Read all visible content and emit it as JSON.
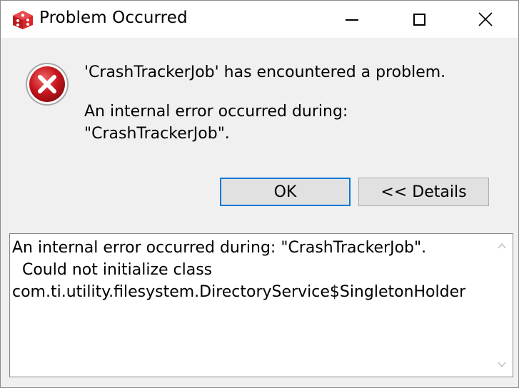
{
  "window": {
    "title": "Problem Occurred",
    "buttons": {
      "minimize": "minimize",
      "maximize": "maximize",
      "close": "close"
    }
  },
  "message": {
    "headline": "'CrashTrackerJob' has encountered a problem.",
    "detail_line1": "An internal error occurred during:",
    "detail_line2": "\"CrashTrackerJob\"."
  },
  "buttons": {
    "ok_label": "OK",
    "details_label": "<< Details"
  },
  "details": {
    "text": "An internal error occurred during: \"CrashTrackerJob\".\n  Could not initialize class\ncom.ti.utility.filesystem.DirectoryService$SingletonHolder"
  },
  "icons": {
    "app": "app-cube-icon",
    "error": "error-icon",
    "scroll_up": "chevron-up-icon",
    "scroll_down": "chevron-down-icon"
  },
  "colors": {
    "error_red": "#c8161e",
    "app_icon_red": "#d9262b",
    "focus_border": "#0078d7",
    "button_bg": "#e1e1e1",
    "dialog_bg": "#f0f0f0"
  }
}
